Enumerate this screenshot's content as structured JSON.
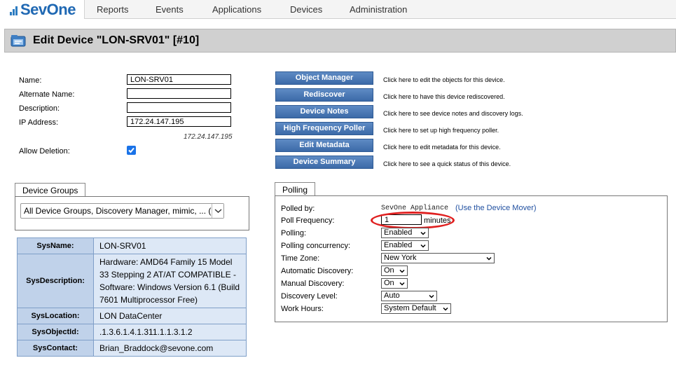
{
  "app": {
    "logo_text": "SevOne"
  },
  "nav": {
    "items": [
      "Reports",
      "Events",
      "Applications",
      "Devices",
      "Administration"
    ]
  },
  "page": {
    "title": "Edit Device \"LON-SRV01\" [#10]"
  },
  "device": {
    "name_label": "Name:",
    "name_value": "LON-SRV01",
    "alt_label": "Alternate Name:",
    "alt_value": "",
    "desc_label": "Description:",
    "desc_value": "",
    "ip_label": "IP Address:",
    "ip_value": "172.24.147.195",
    "ip_resolved": "172.24.147.195",
    "allow_deletion_label": "Allow Deletion:",
    "allow_deletion_checked": true
  },
  "actions": [
    {
      "label": "Object Manager",
      "desc": "Click here to edit the objects for this device."
    },
    {
      "label": "Rediscover",
      "desc": "Click here to have this device rediscovered."
    },
    {
      "label": "Device Notes",
      "desc": "Click here to see device notes and discovery logs."
    },
    {
      "label": "High Frequency Poller",
      "desc": "Click here to set up high frequency poller."
    },
    {
      "label": "Edit Metadata",
      "desc": "Click here to edit metadata for this device."
    },
    {
      "label": "Device Summary",
      "desc": "Click here to see a quick status of this device."
    }
  ],
  "device_groups": {
    "tab": "Device Groups",
    "selected": "All Device Groups, Discovery Manager, mimic, ... ("
  },
  "sysinfo": [
    {
      "key": "SysName:",
      "value": "LON-SRV01"
    },
    {
      "key": "SysDescription:",
      "value": "Hardware: AMD64 Family 15 Model 33 Stepping 2 AT/AT COMPATIBLE - Software: Windows Version 6.1 (Build 7601 Multiprocessor Free)"
    },
    {
      "key": "SysLocation:",
      "value": "LON DataCenter"
    },
    {
      "key": "SysObjectId:",
      "value": ".1.3.6.1.4.1.311.1.1.3.1.2"
    },
    {
      "key": "SysContact:",
      "value": "Brian_Braddock@sevone.com"
    }
  ],
  "polling": {
    "tab": "Polling",
    "polled_by_label": "Polled by:",
    "polled_by_value": "SevOne Appliance",
    "mover_link": "(Use the Device Mover)",
    "freq_label": "Poll Frequency:",
    "freq_value": "1",
    "freq_unit": "minutes",
    "polling_label": "Polling:",
    "polling_value": "Enabled",
    "concurrency_label": "Polling concurrency:",
    "concurrency_value": "Enabled",
    "tz_label": "Time Zone:",
    "tz_value": "New York",
    "auto_disc_label": "Automatic Discovery:",
    "auto_disc_value": "On",
    "manual_disc_label": "Manual Discovery:",
    "manual_disc_value": "On",
    "disc_level_label": "Discovery Level:",
    "disc_level_value": "Auto",
    "work_hours_label": "Work Hours:",
    "work_hours_value": "System Default"
  },
  "colors": {
    "accent": "#1f68b3",
    "button": "#4a78b5",
    "highlight_circle": "#e02020"
  }
}
